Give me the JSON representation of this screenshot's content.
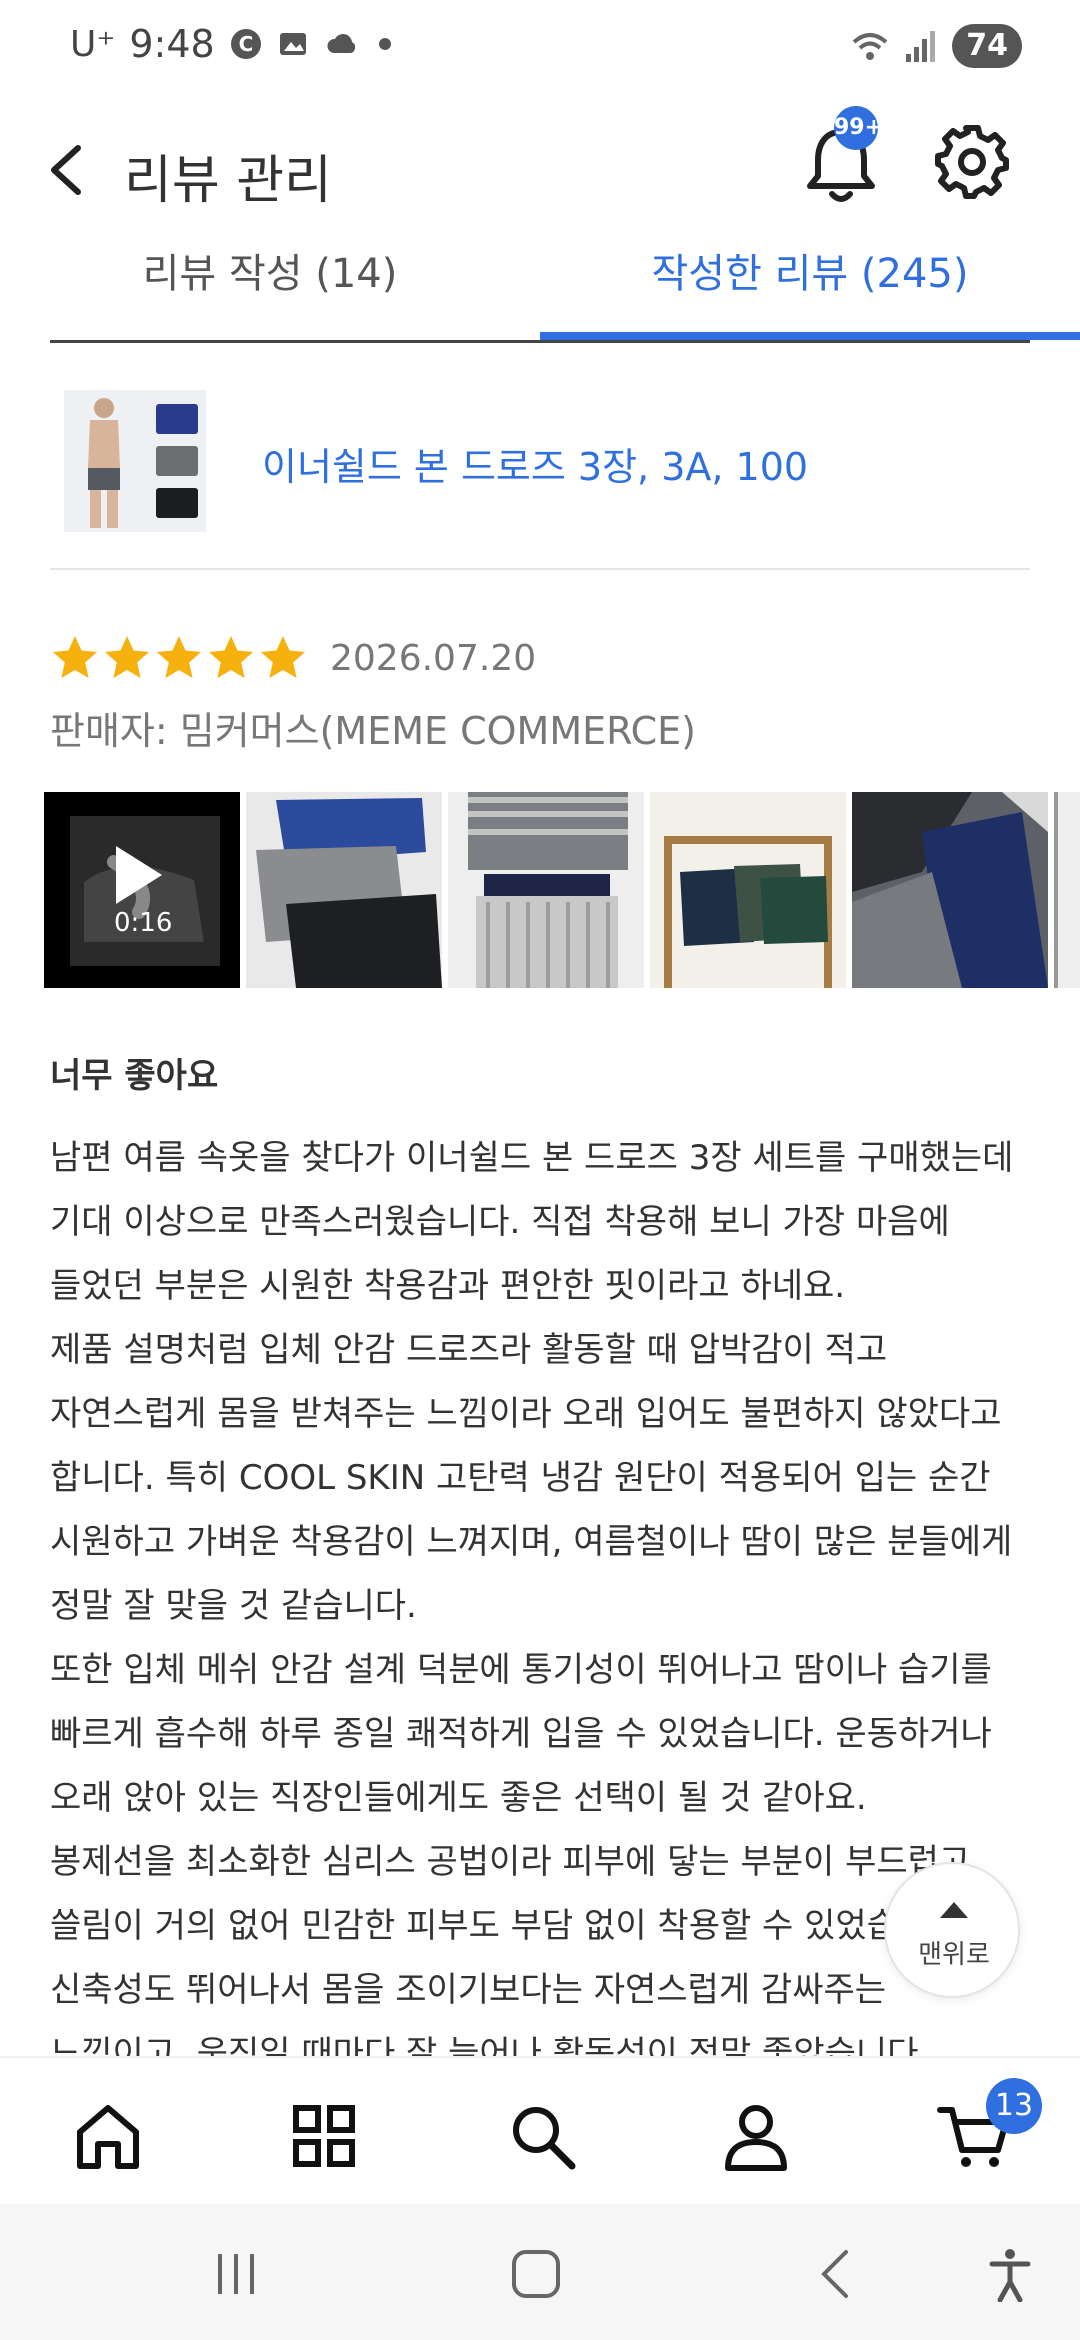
{
  "status_bar": {
    "carrier": "U⁺",
    "time": "9:48",
    "battery": "74"
  },
  "header": {
    "title": "리뷰 관리",
    "notification_badge": "99+"
  },
  "tabs": [
    {
      "label": "리뷰 작성 (14)",
      "active": false
    },
    {
      "label": "작성한 리뷰 (245)",
      "active": true
    }
  ],
  "product": {
    "name": "이너쉴드 본 드로즈 3장, 3A, 100"
  },
  "review": {
    "rating": 5,
    "date": "2026.07.20",
    "seller": "판매자: 밈커머스(MEME COMMERCE)",
    "video_duration": "0:16",
    "title": "너무 좋아요",
    "body": "남편 여름 속옷을 찾다가 이너쉴드 본 드로즈 3장 세트를 구매했는데\n기대 이상으로 만족스러웠습니다. 직접 착용해 보니 가장 마음에\n들었던 부분은 시원한 착용감과 편안한 핏이라고 하네요.\n제품 설명처럼 입체 안감 드로즈라 활동할 때 압박감이 적고\n자연스럽게 몸을 받쳐주는 느낌이라 오래 입어도 불편하지 않았다고\n합니다. 특히 COOL SKIN 고탄력 냉감 원단이 적용되어 입는 순간\n시원하고 가벼운 착용감이 느껴지며, 여름철이나 땀이 많은 분들에게\n정말 잘 맞을 것 같습니다.\n또한 입체 메쉬 안감 설계 덕분에 통기성이 뛰어나고 땀이나 습기를\n빠르게 흡수해 하루 종일 쾌적하게 입을 수 있었습니다. 운동하거나\n오래 앉아 있는 직장인들에게도 좋은 선택이 될 것 같아요.\n봉제선을 최소화한 심리스 공법이라 피부에 닿는 부분이 부드럽고\n쓸림이 거의 없어 민감한 피부도 부담 없이 착용할 수 있었습니다.\n신축성도 뛰어나서 몸을 조이기보다는 자연스럽게 감싸주는\n느낌이고, 움직일 때마다 잘 늘어나 활동성이 정말 좋았습니다."
  },
  "to_top": {
    "label": "맨위로"
  },
  "bottom_nav": {
    "cart_badge": "13"
  },
  "colors": {
    "accent": "#2f6fe0",
    "star": "#f6b10e"
  }
}
